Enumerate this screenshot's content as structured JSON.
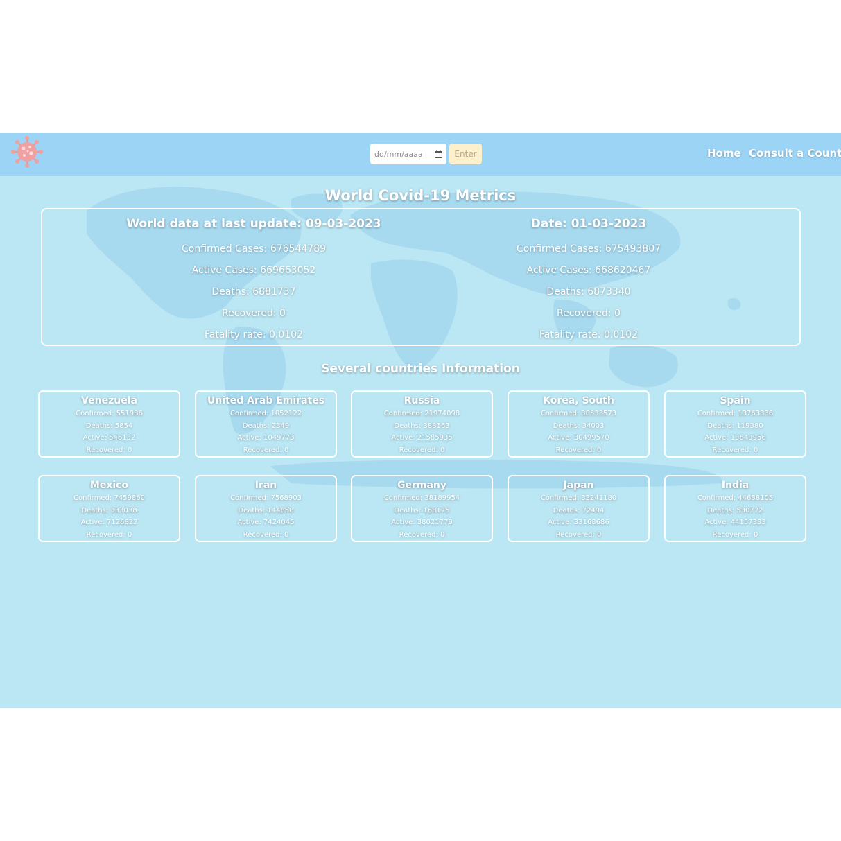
{
  "colors": {
    "page_bg": "#bbe6f3",
    "navbar_bg": "#9cd4f5",
    "map_fill": "#a7d9ef",
    "enter_bg": "#fcf1cc",
    "virus_color": "#f0a0a0"
  },
  "navbar": {
    "logo_icon": "virus-icon",
    "date_placeholder": "dd/mm/aaaa",
    "enter_label": "Enter",
    "links": {
      "home": "Home",
      "consult": "Consult a Country"
    }
  },
  "main": {
    "title": "World Covid-19 Metrics",
    "world": {
      "latest": {
        "heading": "World data at last update: 09-03-2023",
        "confirmed": "Confirmed Cases: 676544789",
        "active": "Active Cases: 669663052",
        "deaths": "Deaths: 6881737",
        "recovered": "Recovered: 0",
        "fatality": "Fatality rate: 0.0102"
      },
      "selected": {
        "heading": "Date: 01-03-2023",
        "confirmed": "Confirmed Cases: 675493807",
        "active": "Active Cases: 668620467",
        "deaths": "Deaths: 6873340",
        "recovered": "Recovered: 0",
        "fatality": "Fatality rate: 0.0102"
      }
    },
    "countries_title": "Several countries Information",
    "countries": [
      {
        "name": "Venezuela",
        "confirmed": "Confirmed: 551986",
        "deaths": "Deaths: 5854",
        "active": "Active: 546132",
        "recovered": "Recovered: 0"
      },
      {
        "name": "United Arab Emirates",
        "confirmed": "Confirmed: 1052122",
        "deaths": "Deaths: 2349",
        "active": "Active: 1049773",
        "recovered": "Recovered: 0"
      },
      {
        "name": "Russia",
        "confirmed": "Confirmed: 21974098",
        "deaths": "Deaths: 388163",
        "active": "Active: 21585935",
        "recovered": "Recovered: 0"
      },
      {
        "name": "Korea, South",
        "confirmed": "Confirmed: 30533573",
        "deaths": "Deaths: 34003",
        "active": "Active: 30499570",
        "recovered": "Recovered: 0"
      },
      {
        "name": "Spain",
        "confirmed": "Confirmed: 13763336",
        "deaths": "Deaths: 119380",
        "active": "Active: 13643956",
        "recovered": "Recovered: 0"
      },
      {
        "name": "Mexico",
        "confirmed": "Confirmed: 7459860",
        "deaths": "Deaths: 333038",
        "active": "Active: 7126822",
        "recovered": "Recovered: 0"
      },
      {
        "name": "Iran",
        "confirmed": "Confirmed: 7568903",
        "deaths": "Deaths: 144858",
        "active": "Active: 7424045",
        "recovered": "Recovered: 0"
      },
      {
        "name": "Germany",
        "confirmed": "Confirmed: 38189954",
        "deaths": "Deaths: 168175",
        "active": "Active: 38021779",
        "recovered": "Recovered: 0"
      },
      {
        "name": "Japan",
        "confirmed": "Confirmed: 33241180",
        "deaths": "Deaths: 72494",
        "active": "Active: 33168686",
        "recovered": "Recovered: 0"
      },
      {
        "name": "India",
        "confirmed": "Confirmed: 44688105",
        "deaths": "Deaths: 530772",
        "active": "Active: 44157333",
        "recovered": "Recovered: 0"
      }
    ]
  }
}
